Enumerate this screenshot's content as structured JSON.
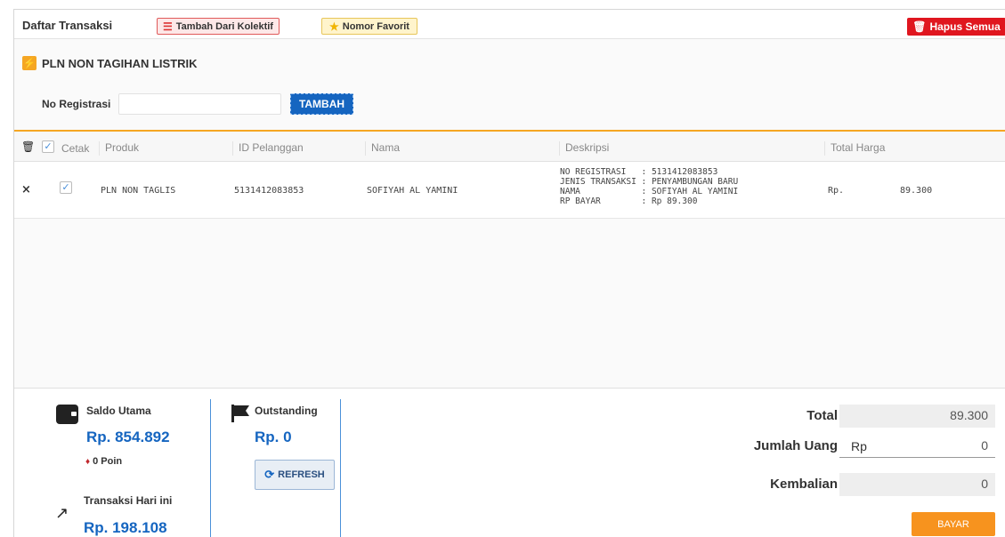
{
  "header": {
    "title": "Daftar Transaksi",
    "kolektif_label": "Tambah Dari Kolektif",
    "favorit_label": "Nomor Favorit",
    "hapus_label": "Hapus Semua"
  },
  "product": {
    "title": "PLN NON TAGIHAN LISTRIK",
    "noreg_label": "No Registrasi",
    "noreg_value": "",
    "add_label": "TAMBAH"
  },
  "table": {
    "columns": [
      "Cetak",
      "Produk",
      "ID Pelanggan",
      "Nama",
      "Deskripsi",
      "Total Harga"
    ],
    "rows": [
      {
        "remove": "×",
        "checked": "✓",
        "produk": "PLN NON TAGLIS",
        "id_pelanggan": "5131412083853",
        "nama": "SOFIYAH AL YAMINI",
        "deskripsi": "NO REGISTRASI   : 5131412083853\nJENIS TRANSAKSI : PENYAMBUNGAN BARU\nNAMA            : SOFIYAH AL YAMINI\nRP BAYAR        : Rp 89.300",
        "currency": "Rp.",
        "total": "89.300"
      }
    ]
  },
  "footer": {
    "saldo_label": "Saldo Utama",
    "saldo_value": "Rp. 854.892",
    "poin": "0 Poin",
    "trx_label": "Transaksi Hari ini",
    "trx_value": "Rp. 198.108",
    "outstanding_label": "Outstanding",
    "outstanding_value": "Rp. 0",
    "refresh_label": "REFRESH",
    "total_label": "Total",
    "jumlah_label": "Jumlah Uang",
    "kembalian_label": "Kembalian",
    "rp": "Rp",
    "total_value": "89.300",
    "jumlah_value": "0",
    "kembalian_value": "0",
    "bayar_label": "BAYAR"
  },
  "colors": {
    "accent_blue": "#1565c0",
    "accent_orange": "#f5a623",
    "danger_red": "#e0161f"
  }
}
